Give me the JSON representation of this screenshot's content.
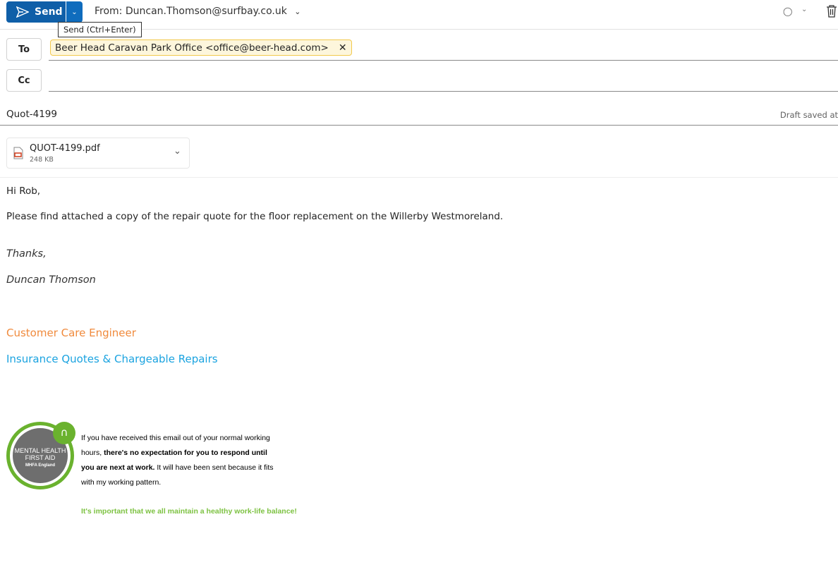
{
  "toolbar": {
    "send_label": "Send",
    "send_tooltip": "Send (Ctrl+Enter)",
    "from": "From: Duncan.Thomson@surfbay.co.uk"
  },
  "recipients": {
    "to_label": "To",
    "cc_label": "Cc",
    "to": [
      {
        "display": "Beer Head Caravan Park Office <office@beer-head.com>"
      }
    ]
  },
  "subject": "Quot-4199",
  "draft_status": "Draft saved at",
  "attachment": {
    "name": "QUOT-4199.pdf",
    "size": "248 KB"
  },
  "body": {
    "greeting": "Hi Rob,",
    "message": "Please find attached a copy of the repair quote for the floor replacement on the Willerby Westmoreland.",
    "signoff": "Thanks,",
    "name": "Duncan Thomson",
    "title": "Customer Care Engineer",
    "department": "Insurance Quotes & Chargeable Repairs"
  },
  "signature": {
    "badge_line1": "MENTAL HEALTH",
    "badge_line2": "FIRST AID",
    "badge_line3": "MHFA England",
    "p1_a": "If you have received this email out of your normal working hours, ",
    "p1_b": "there's no expectation for you to respond until you are next at work.",
    "p1_c": " It will have been sent because it fits with my working pattern.",
    "balance": "It's important that we all maintain a healthy work-life balance!"
  },
  "colors": {
    "accent": "#0f6cbd",
    "orange": "#f08a3c",
    "blue": "#1aa3e0",
    "green": "#7dc242"
  }
}
